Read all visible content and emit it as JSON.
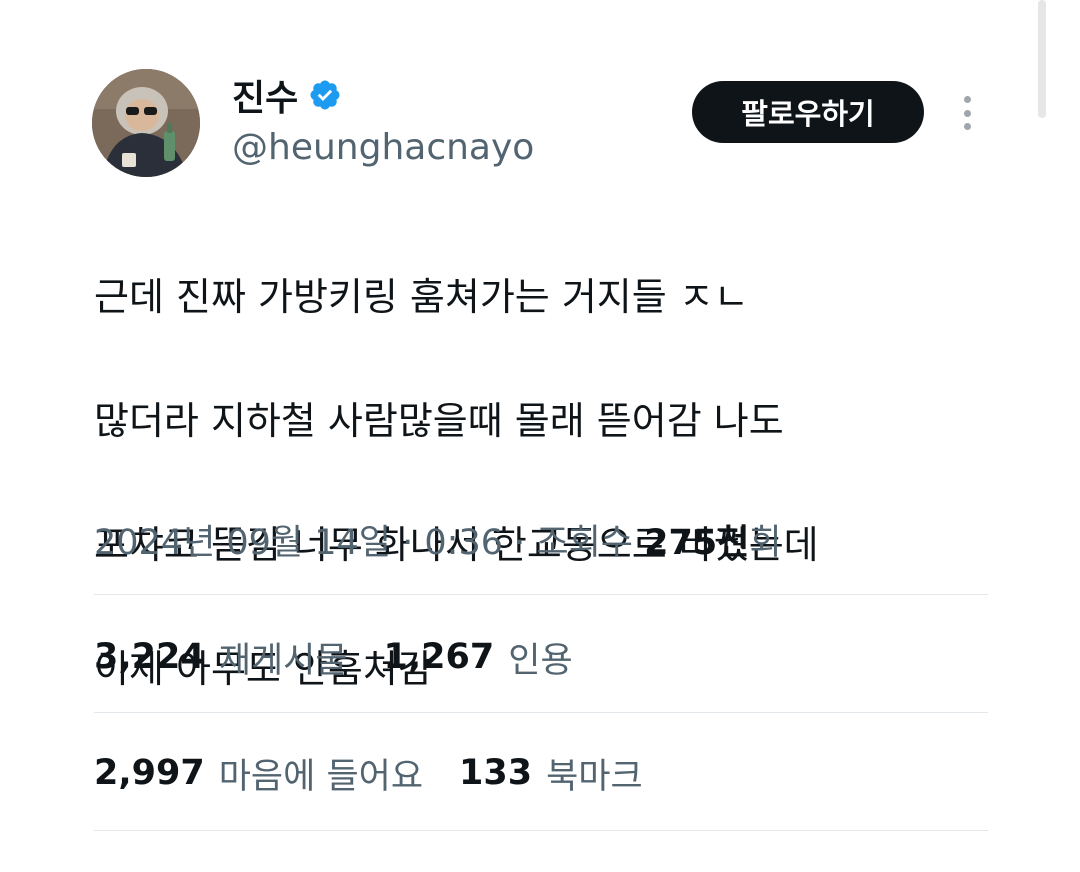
{
  "author": {
    "display_name": "진수",
    "handle": "@heunghacnayo",
    "verified_icon": "verified-badge-icon",
    "verified_color": "#1d9bf0"
  },
  "actions": {
    "follow_label": "팔로우하기",
    "more_icon": "more-vertical-icon"
  },
  "tweet": {
    "lines": [
      "근데 진짜 가방키링 훔쳐가는 거지들 ㅈㄴ",
      "많더라 지하철 사람많을때 몰래 뜯어감 나도",
      "포챠코 뜯김 너무 화나서 한교동으로 바꿨는데",
      "이제 아무도 안훔쳐감"
    ]
  },
  "meta": {
    "date": "2024년 09월 14일",
    "separator": " · ",
    "time": "0:36",
    "views_label": "조회수",
    "views_num": "275천",
    "views_suffix": "회"
  },
  "stats": {
    "reposts": {
      "num": "3,224",
      "label": "재게시물"
    },
    "quotes": {
      "num": "1,267",
      "label": "인용"
    },
    "likes": {
      "num": "2,997",
      "label": "마음에 들어요"
    },
    "bookmarks": {
      "num": "133",
      "label": "북마크"
    }
  },
  "colors": {
    "text_primary": "#0f1419",
    "text_secondary": "#536471",
    "button_bg": "#0f1419",
    "divider": "#e3e8ec"
  }
}
